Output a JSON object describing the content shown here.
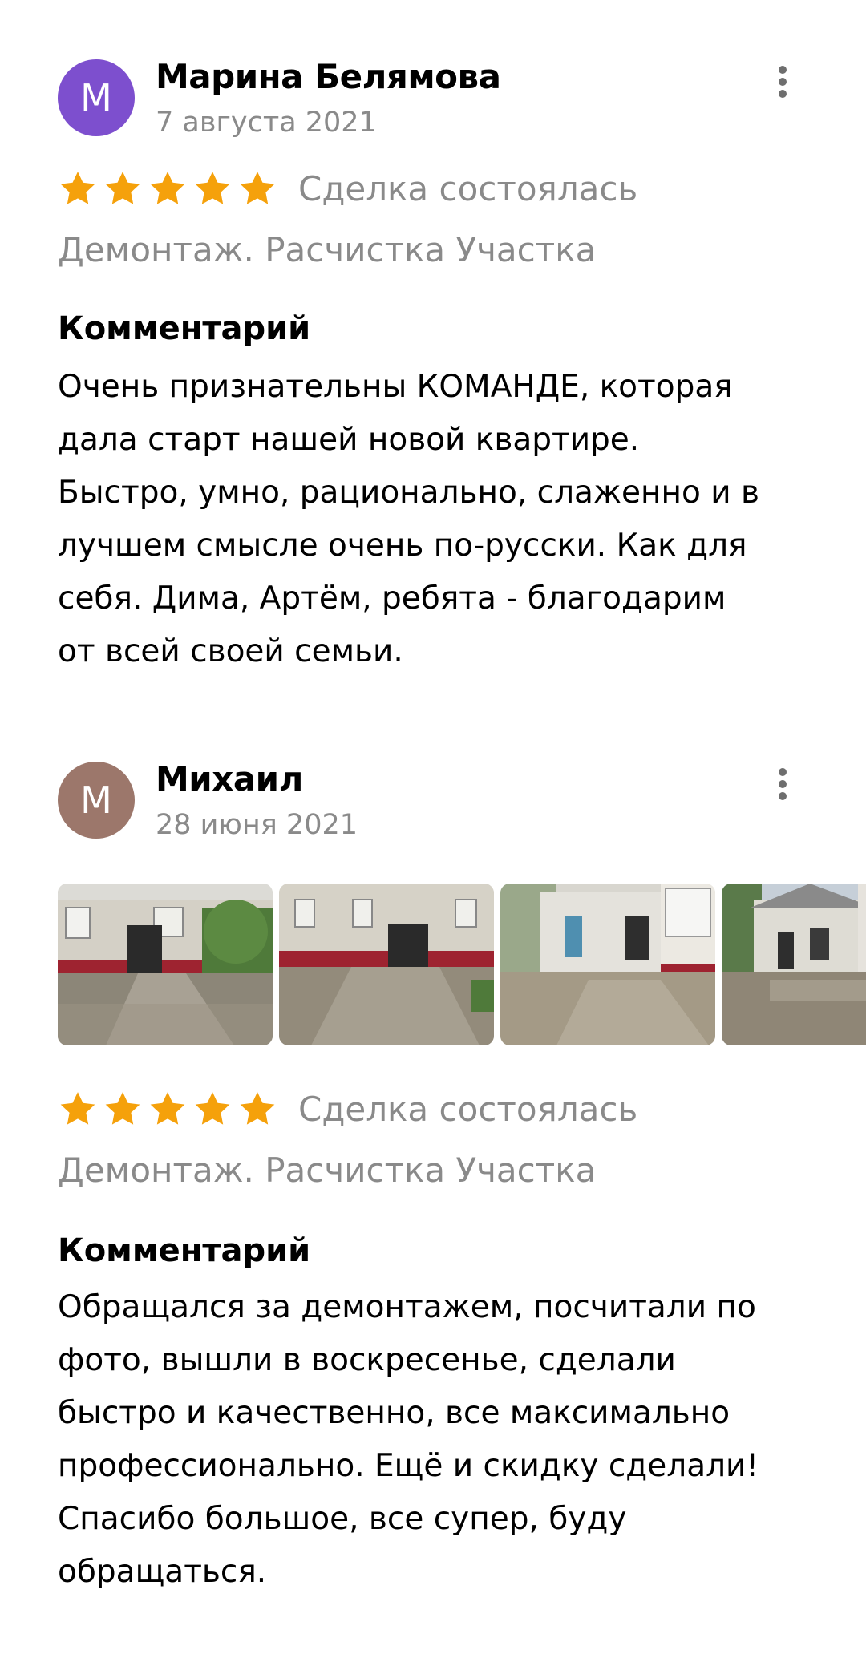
{
  "reviews": [
    {
      "avatar_letter": "М",
      "avatar_color": "#7d4fce",
      "author": "Марина Белямова",
      "date": "7 августа 2021",
      "rating": 5,
      "deal_status": "Сделка состоялась",
      "category": "Демонтаж. Расчистка Участка",
      "comment_heading": "Комментарий",
      "comment": "Очень признательны КОМАНДЕ, которая\nдала старт нашей новой квартире.\nБыстро, умно, рационально, слаженно и в\nлучшем смысле очень по-русски. Как для\nсебя. Дима, Артём, ребята - благодарим\nот всей своей семьи."
    },
    {
      "avatar_letter": "М",
      "avatar_color": "#9c776b",
      "author": "Михаил",
      "date": "28 июня 2021",
      "rating": 5,
      "deal_status": "Сделка состоялась",
      "category": "Демонтаж. Расчистка Участка",
      "comment_heading": "Комментарий",
      "comment": "Обращался за демонтажем, посчитали по\nфото, вышли в воскресенье, сделали\nбыстро и качественно, все максимально\nпрофессионально. Ещё и скидку сделали!\nСпасибо большое, все супер, буду\nобращаться.",
      "photos": [
        "building-entrance-photo-1",
        "building-entrance-photo-2",
        "building-courtyard-photo-3",
        "building-extension-photo-4"
      ]
    }
  ],
  "colors": {
    "star": "#f5a10b",
    "secondary_text": "#8a8a8a",
    "more_dots": "#6e6e6e"
  },
  "icons": {
    "more": "more-vertical-icon",
    "star": "star-icon"
  }
}
